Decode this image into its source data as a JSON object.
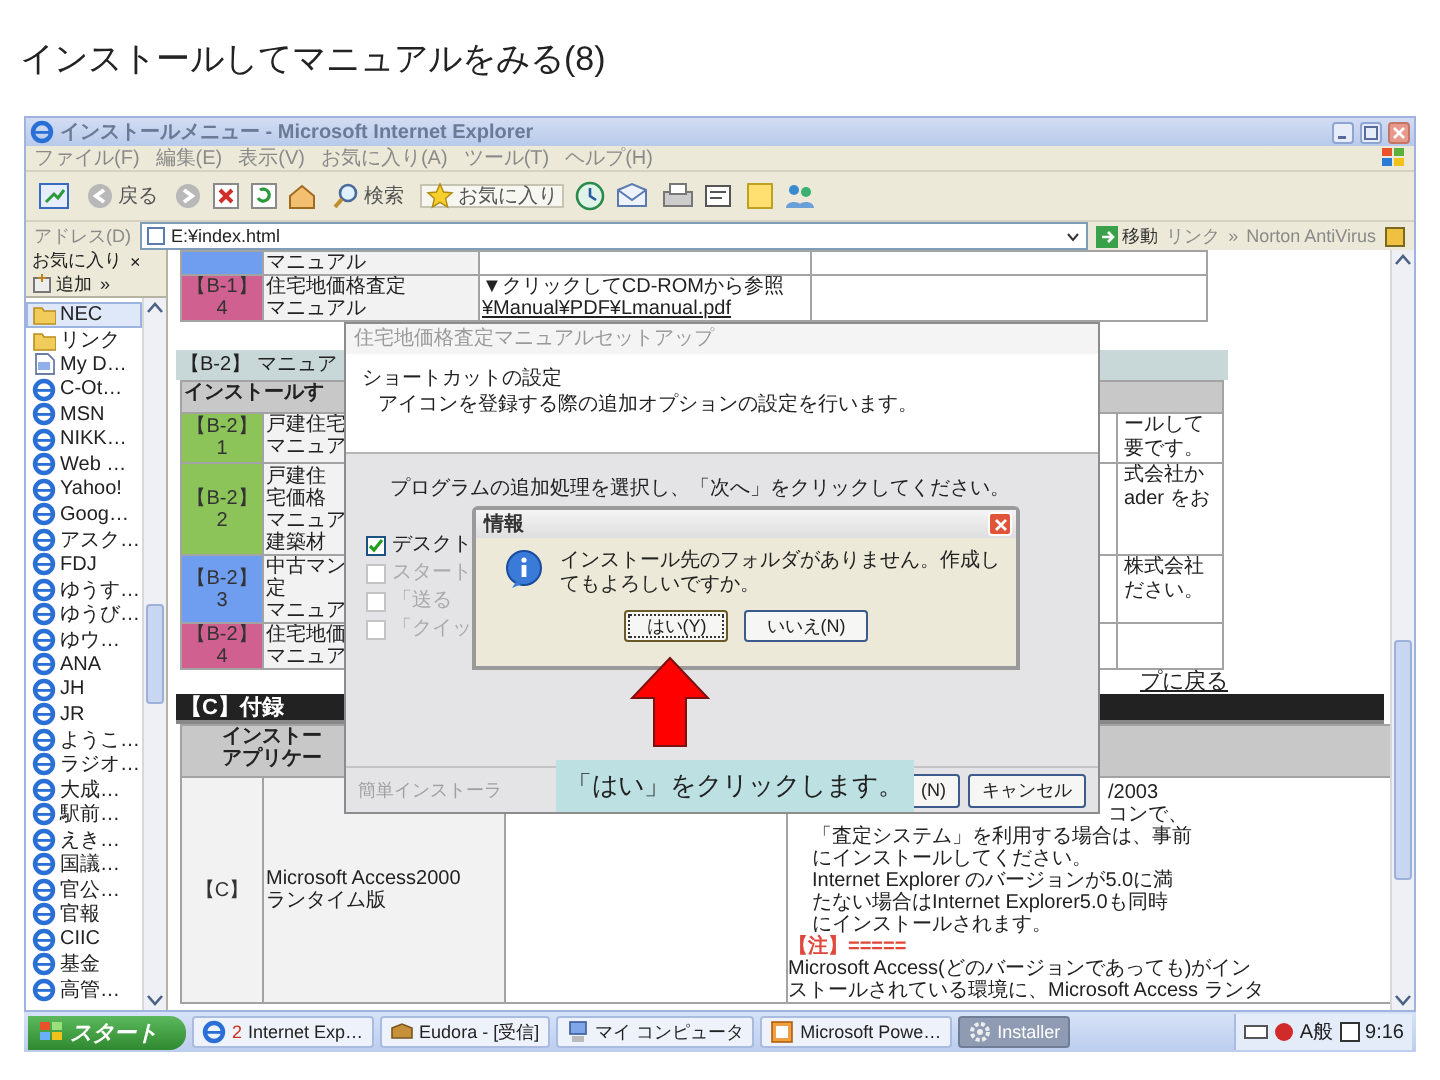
{
  "slide_title": "インストールしてマニュアルをみる(8)",
  "window": {
    "title": "インストールメニュー - Microsoft Internet Explorer"
  },
  "menu": [
    "ファイル(F)",
    "編集(E)",
    "表示(V)",
    "お気に入り(A)",
    "ツール(T)",
    "ヘルプ(H)"
  ],
  "toolbar": {
    "back": "戻る",
    "search": "検索",
    "favorites": "お気に入り"
  },
  "address_bar": {
    "label": "アドレス(D)",
    "value": "E:¥index.html",
    "go": "移動",
    "links": "リンク",
    "chevron": "»",
    "extension": "Norton AntiVirus"
  },
  "favorites": {
    "title": "お気に入り",
    "close": "×",
    "add": "追加",
    "chevron": "»",
    "items": [
      {
        "label": "NEC",
        "kind": "folder",
        "selected": true
      },
      {
        "label": "リンク",
        "kind": "folder",
        "selected": false
      },
      {
        "label": "My D…",
        "kind": "document",
        "selected": false
      },
      {
        "label": "C-Ot…",
        "kind": "page",
        "selected": false
      },
      {
        "label": "MSN",
        "kind": "page",
        "selected": false
      },
      {
        "label": "NIKK…",
        "kind": "page",
        "selected": false
      },
      {
        "label": "Web …",
        "kind": "page",
        "selected": false
      },
      {
        "label": "Yahoo!",
        "kind": "page",
        "selected": false
      },
      {
        "label": "Goog…",
        "kind": "page",
        "selected": false
      },
      {
        "label": "アスク…",
        "kind": "page",
        "selected": false
      },
      {
        "label": "FDJ",
        "kind": "page",
        "selected": false
      },
      {
        "label": "ゆうす…",
        "kind": "page",
        "selected": false
      },
      {
        "label": "ゆうび…",
        "kind": "page",
        "selected": false
      },
      {
        "label": "ゆウ…",
        "kind": "page",
        "selected": false
      },
      {
        "label": "ANA",
        "kind": "page",
        "selected": false
      },
      {
        "label": "JH",
        "kind": "page",
        "selected": false
      },
      {
        "label": "JR",
        "kind": "page",
        "selected": false
      },
      {
        "label": "ようこ…",
        "kind": "page",
        "selected": false
      },
      {
        "label": "ラジオ…",
        "kind": "page",
        "selected": false
      },
      {
        "label": "大成…",
        "kind": "page",
        "selected": false
      },
      {
        "label": "駅前…",
        "kind": "page",
        "selected": false
      },
      {
        "label": "えき…",
        "kind": "page",
        "selected": false
      },
      {
        "label": "国議…",
        "kind": "page",
        "selected": false
      },
      {
        "label": "官公…",
        "kind": "page",
        "selected": false
      },
      {
        "label": "官報",
        "kind": "page",
        "selected": false
      },
      {
        "label": "CIIC",
        "kind": "page",
        "selected": false
      },
      {
        "label": "基金",
        "kind": "page",
        "selected": false
      },
      {
        "label": "高管…",
        "kind": "page",
        "selected": false
      }
    ]
  },
  "b1_table": {
    "rows": [
      {
        "color": "#6f9df0",
        "lines": [
          "マニュアル"
        ]
      },
      {
        "code": "【B-1】",
        "number": "4",
        "color": "#d0608f",
        "lines": [
          "住宅地価格査定",
          "マニュアル"
        ],
        "note": "▼クリックしてCD-ROMから参照",
        "link": "¥Manual¥PDF¥Lmanual.pdf"
      }
    ]
  },
  "b2_section": {
    "heading": "【B-2】 マニュア",
    "header": "インストールす",
    "rows": [
      {
        "code": "【B-2】",
        "number": "1",
        "color": "#8cc45a",
        "lines": [
          "戸建住宅",
          "マニュア"
        ],
        "notes": [
          "ールして",
          "要です。"
        ]
      },
      {
        "code": "【B-2】",
        "number": "2",
        "color": "#8cc45a",
        "small": "戸建住宅価格",
        "lines": [
          "マニュア",
          "建築材"
        ],
        "notes": [
          "式会社か",
          "ader をお"
        ]
      },
      {
        "code": "【B-2】",
        "number": "3",
        "color": "#6f9df0",
        "lines": [
          "中古マン",
          "定",
          "マニュア"
        ],
        "notes": [
          "株式会社",
          "ださい。"
        ]
      },
      {
        "code": "【B-2】",
        "number": "4",
        "color": "#d0608f",
        "lines": [
          "住宅地価",
          "マニュア"
        ]
      }
    ],
    "back_link": "プに戻る"
  },
  "c_section": {
    "heading": "【C】付録",
    "header": [
      "インストー",
      "アプリケー"
    ],
    "row": {
      "code": "【C】",
      "name": [
        "Microsoft Access2000",
        "ランタイム版"
      ],
      "notes_cut": [
        "/2003",
        "コンで、"
      ],
      "notes": [
        "「査定システム」を利用する場合は、事前",
        "にインストールしてください。",
        "Internet Explorer のバージョンが5.0に満",
        "たない場合はInternet Explorer5.0も同時",
        "にインストールされます。"
      ],
      "warning": "【注】=====",
      "warning_lines": [
        "Microsoft Access(どのバージョンであっても)がイン",
        "ストールされている環境に、Microsoft Access ランタ"
      ]
    }
  },
  "setup_dialog": {
    "title": "住宅地価格査定マニュアルセットアップ",
    "heading": "ショートカットの設定",
    "description": "アイコンを登録する際の追加オプションの設定を行います。",
    "instruction": "プログラムの追加処理を選択し、「次へ」をクリックしてください。",
    "options": [
      {
        "label": "デスクト",
        "checked": true,
        "disabled": false
      },
      {
        "label": "スタート",
        "checked": false,
        "disabled": true
      },
      {
        "label": "「送る",
        "checked": false,
        "disabled": true
      },
      {
        "label": "「クイッ",
        "checked": false,
        "disabled": true
      }
    ],
    "footer": "簡単インストーラ",
    "buttons": [
      "(N)",
      "キャンセル"
    ]
  },
  "info_dialog": {
    "title": "情報",
    "message": "インストール先のフォルダがありません。作成してもよろしいですか。",
    "buttons": [
      {
        "label": "はい(Y)",
        "selected": true
      },
      {
        "label": "いいえ(N)",
        "selected": false
      }
    ]
  },
  "callout": {
    "text": "「はい」をクリックします。"
  },
  "taskbar": {
    "start": "スタート",
    "tasks": [
      {
        "kind": "browser",
        "count": "2",
        "label": "Internet Exp…",
        "selected": false
      },
      {
        "kind": "mail",
        "label": "Eudora - [受信]",
        "selected": false
      },
      {
        "kind": "computer",
        "label": "マイ コンピュータ",
        "selected": false
      },
      {
        "kind": "presentation",
        "label": "Microsoft Powe…",
        "selected": false
      },
      {
        "kind": "installer",
        "label": "Installer",
        "selected": true
      }
    ],
    "ime": "A般",
    "clock": "9:16"
  }
}
